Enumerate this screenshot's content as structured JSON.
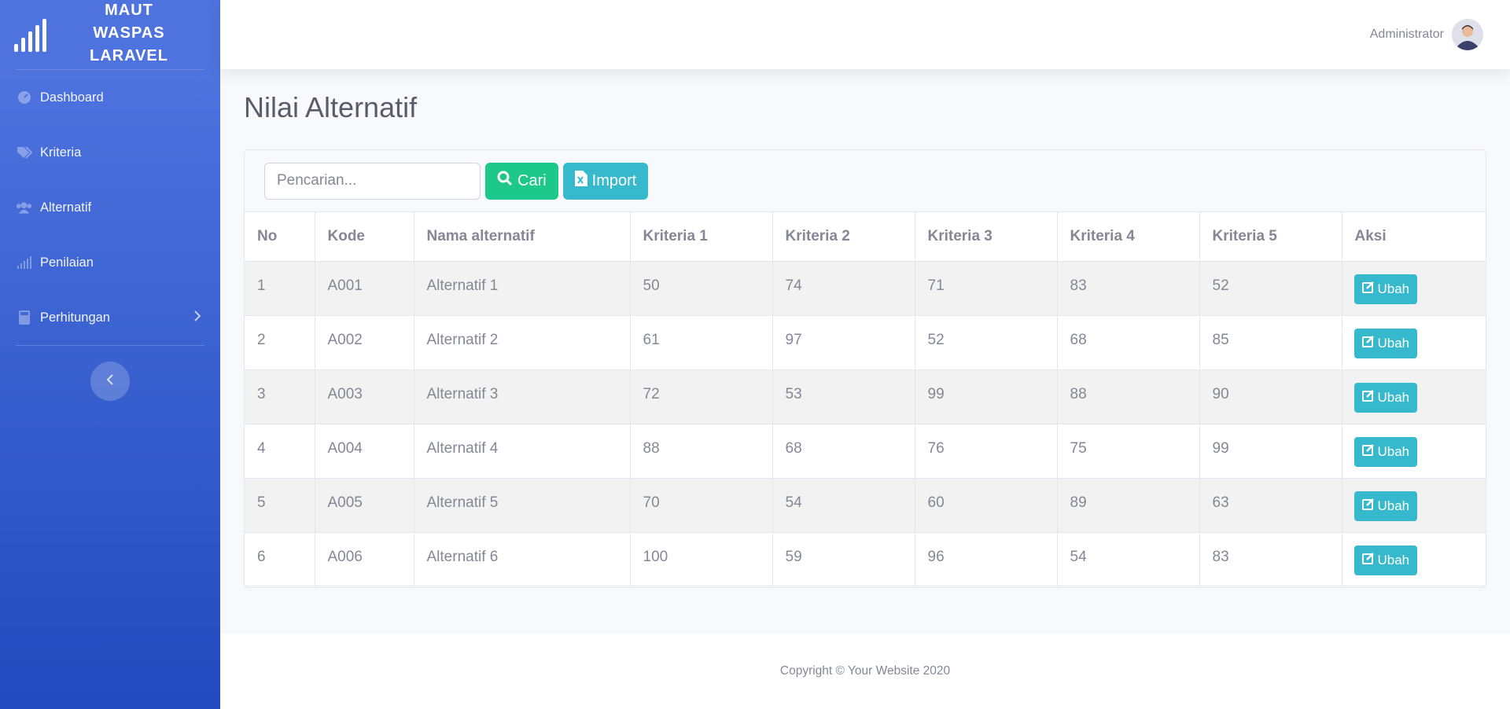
{
  "brand": {
    "line1": "MAUT",
    "line2": "WASPAS",
    "line3": "LARAVEL",
    "icon": "signal-bars-icon"
  },
  "sidebar": {
    "items": [
      {
        "label": "Dashboard",
        "icon": "tachometer-icon"
      },
      {
        "label": "Kriteria",
        "icon": "tags-icon"
      },
      {
        "label": "Alternatif",
        "icon": "users-icon"
      },
      {
        "label": "Penilaian",
        "icon": "signal-icon"
      },
      {
        "label": "Perhitungan",
        "icon": "calculator-icon",
        "has_submenu": true
      }
    ],
    "toggle_icon": "chevron-left-icon"
  },
  "topbar": {
    "user_name": "Administrator",
    "avatar": "user-avatar"
  },
  "page": {
    "title": "Nilai Alternatif"
  },
  "toolbar": {
    "search_placeholder": "Pencarian...",
    "search_label": "Cari",
    "import_label": "Import"
  },
  "table": {
    "headers": [
      "No",
      "Kode",
      "Nama alternatif",
      "Kriteria 1",
      "Kriteria 2",
      "Kriteria 3",
      "Kriteria 4",
      "Kriteria 5",
      "Aksi"
    ],
    "rows": [
      [
        "1",
        "A001",
        "Alternatif 1",
        "50",
        "74",
        "71",
        "83",
        "52"
      ],
      [
        "2",
        "A002",
        "Alternatif 2",
        "61",
        "97",
        "52",
        "68",
        "85"
      ],
      [
        "3",
        "A003",
        "Alternatif 3",
        "72",
        "53",
        "99",
        "88",
        "90"
      ],
      [
        "4",
        "A004",
        "Alternatif 4",
        "88",
        "68",
        "76",
        "75",
        "99"
      ],
      [
        "5",
        "A005",
        "Alternatif 5",
        "70",
        "54",
        "60",
        "89",
        "63"
      ],
      [
        "6",
        "A006",
        "Alternatif 6",
        "100",
        "59",
        "96",
        "54",
        "83"
      ]
    ],
    "action_label": "Ubah"
  },
  "footer": {
    "text": "Copyright © Your Website 2020"
  },
  "colors": {
    "primary": "#4e73df",
    "success": "#1cc88a",
    "info": "#36b9cc"
  }
}
